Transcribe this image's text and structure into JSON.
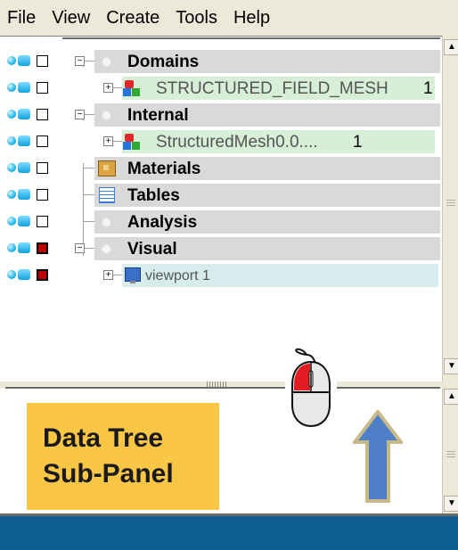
{
  "menu": [
    "File",
    "View",
    "Create",
    "Tools",
    "Help"
  ],
  "tree": {
    "rows": [
      {
        "label": "Domains",
        "style": "bold",
        "vis_on": false
      },
      {
        "label": "STRUCTURED_FIELD_MESH",
        "count": "1",
        "style": "normal",
        "vis_on": false
      },
      {
        "label": "Internal",
        "style": "bold",
        "vis_on": false
      },
      {
        "label": "StructuredMesh0.0....",
        "count": "1",
        "style": "normal",
        "vis_on": false
      },
      {
        "label": "Materials",
        "style": "bold",
        "vis_on": false
      },
      {
        "label": "Tables",
        "style": "bold",
        "vis_on": false
      },
      {
        "label": "Analysis",
        "style": "bold",
        "vis_on": false
      },
      {
        "label": "Visual",
        "style": "bold",
        "vis_on": true
      },
      {
        "label": "viewport 1",
        "style": "normal",
        "vis_on": true
      }
    ],
    "icons": [
      "mesh-icon",
      "materials-icon",
      "tables-icon",
      "viewport-icon",
      "eye-icon",
      "cube-icon"
    ]
  },
  "callout": {
    "line1": "Data Tree",
    "line2": "Sub-Panel"
  },
  "colors": {
    "callout": "#f9c645",
    "bottom_bar": "#0d5d91",
    "arrow": "#4f7fc6"
  }
}
